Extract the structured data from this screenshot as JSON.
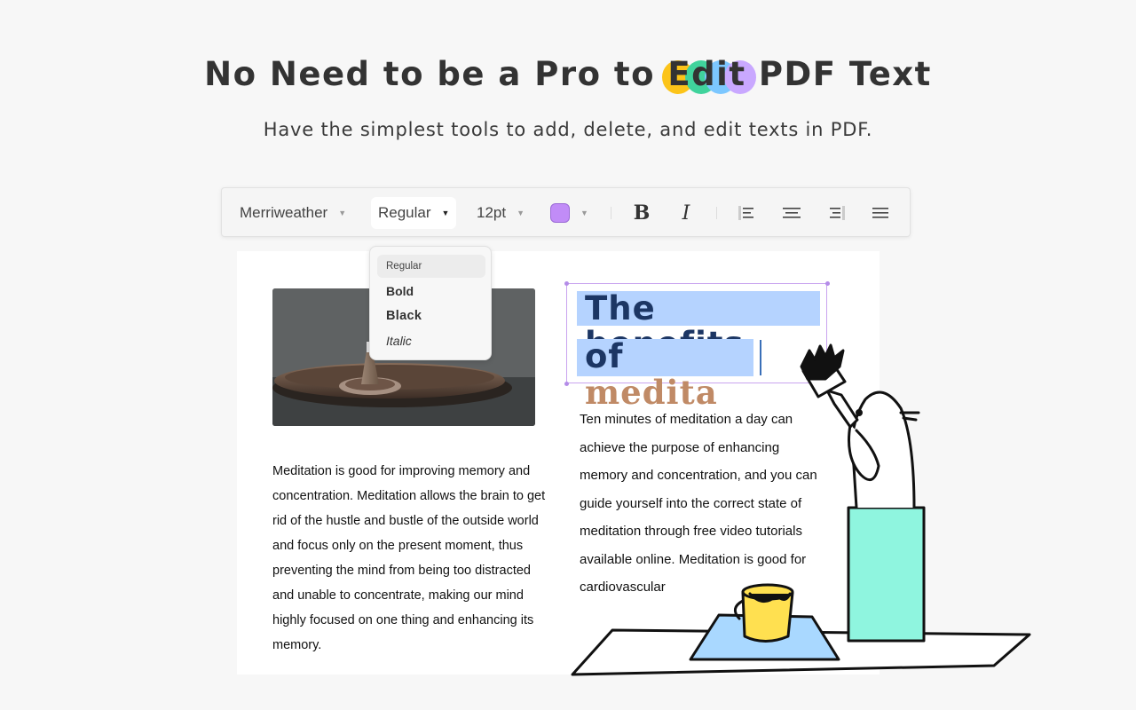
{
  "hero": {
    "headline_before": "No Need to be a Pro to ",
    "headline_highlight": "Edit",
    "headline_after": " PDF Text",
    "highlight_colors": [
      "#fcc419",
      "#40d39c",
      "#7cc7ff",
      "#c9a8ff"
    ],
    "subheadline": "Have the simplest tools to add, delete, and edit texts in PDF."
  },
  "toolbar": {
    "font_family": "Merriweather",
    "font_style": "Regular",
    "font_size": "12pt",
    "text_color": "#c18cf7",
    "bold_label": "B",
    "italic_label": "I",
    "align_left": "align-left-icon",
    "align_center": "align-center-icon",
    "align_right": "align-right-icon",
    "align_justify": "align-justify-icon"
  },
  "style_dropdown": {
    "options": [
      "Regular",
      "Bold",
      "Black",
      "Italic"
    ],
    "selected": "Regular"
  },
  "document": {
    "title_line1": "The benefits",
    "title_line2_prefix": "of ",
    "title_line2_edit": "medita",
    "left_paragraph": "Meditation is good for improving memory and concentration. Meditation allows the brain to get rid of the hustle and bustle of the outside world and focus only on the present moment, thus preventing the mind from being too distracted and unable to concentrate, making our mind highly focused on one thing and enhancing its memory.",
    "right_paragraph": "Ten minutes of meditation a day can achieve the purpose of enhancing memory and concentration, and you can guide yourself into the correct state of meditation through free video tutorials available online. Meditation is good for cardiovascular",
    "image": "incense-cone-on-dish-photo"
  }
}
